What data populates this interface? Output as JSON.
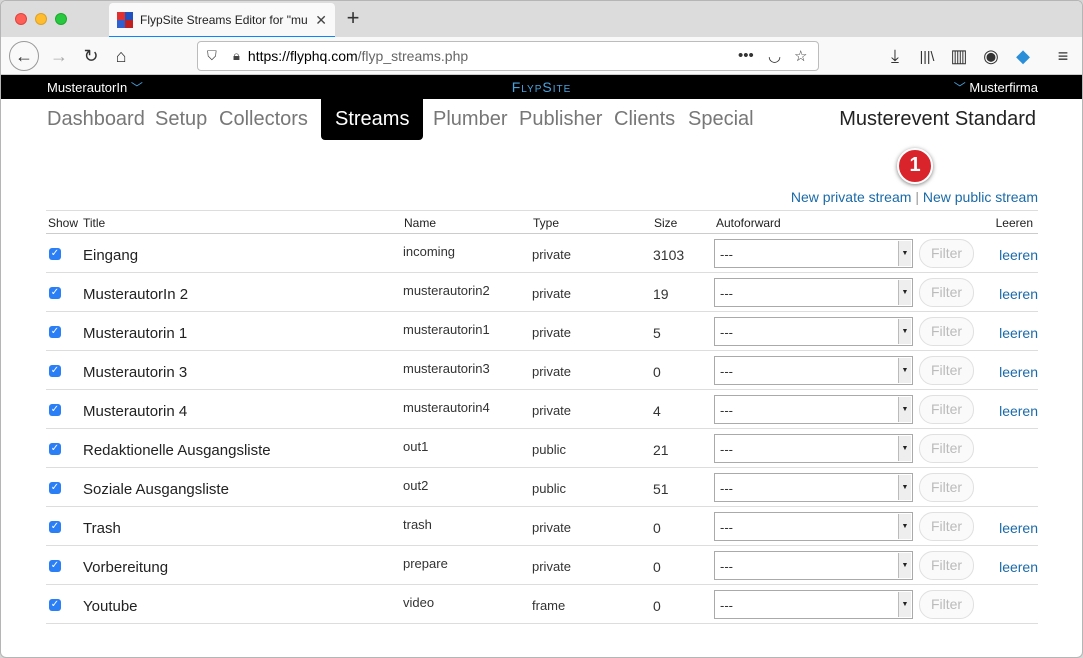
{
  "browser": {
    "tab_title": "FlypSite Streams Editor for \"mu",
    "url_host": "https://flyphq.com",
    "url_path": "/flyp_streams.php"
  },
  "header": {
    "user": "MusterautorIn",
    "brand": "FlypSite",
    "company": "Musterfirma"
  },
  "nav": {
    "items": [
      "Dashboard",
      "Setup",
      "Collectors",
      "Streams",
      "Plumber",
      "Publisher",
      "Clients",
      "Special"
    ],
    "active": "Streams",
    "event": "Musterevent Standard"
  },
  "badge": "1",
  "links": {
    "new_private": "New private stream",
    "separator": "|",
    "new_public": "New public stream"
  },
  "table": {
    "columns": {
      "show": "Show",
      "title": "Title",
      "name": "Name",
      "type": "Type",
      "size": "Size",
      "autoforward": "Autoforward",
      "leeren": "Leeren"
    },
    "filter_label": "Filter",
    "leeren_label": "leeren",
    "rows": [
      {
        "title": "Eingang",
        "name": "incoming",
        "type": "private",
        "size": "3103",
        "autoforward": "---",
        "leeren": "leeren"
      },
      {
        "title": "MusterautorIn 2",
        "name": "musterautorin2",
        "type": "private",
        "size": "19",
        "autoforward": "---",
        "leeren": "leeren"
      },
      {
        "title": "Musterautorin 1",
        "name": "musterautorin1",
        "type": "private",
        "size": "5",
        "autoforward": "---",
        "leeren": "leeren"
      },
      {
        "title": "Musterautorin 3",
        "name": "musterautorin3",
        "type": "private",
        "size": "0",
        "autoforward": "---",
        "leeren": "leeren"
      },
      {
        "title": "Musterautorin 4",
        "name": "musterautorin4",
        "type": "private",
        "size": "4",
        "autoforward": "---",
        "leeren": "leeren"
      },
      {
        "title": "Redaktionelle Ausgangsliste",
        "name": "out1",
        "type": "public",
        "size": "21",
        "autoforward": "---",
        "leeren": ""
      },
      {
        "title": "Soziale Ausgangsliste",
        "name": "out2",
        "type": "public",
        "size": "51",
        "autoforward": "---",
        "leeren": ""
      },
      {
        "title": "Trash",
        "name": "trash",
        "type": "private",
        "size": "0",
        "autoforward": "---",
        "leeren": "leeren"
      },
      {
        "title": "Vorbereitung",
        "name": "prepare",
        "type": "private",
        "size": "0",
        "autoforward": "---",
        "leeren": "leeren"
      },
      {
        "title": "Youtube",
        "name": "video",
        "type": "frame",
        "size": "0",
        "autoforward": "---",
        "leeren": ""
      }
    ]
  }
}
